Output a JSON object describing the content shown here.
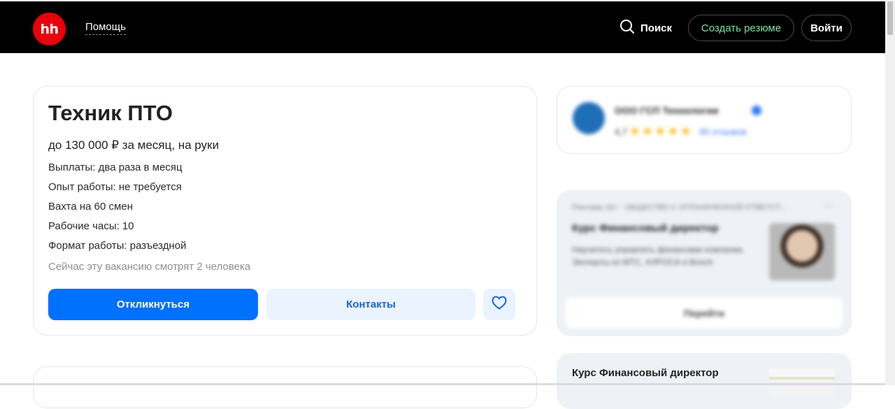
{
  "header": {
    "logo_text": "hh",
    "help_label": "Помощь",
    "search_label": "Поиск",
    "create_resume_label": "Создать резюме",
    "login_label": "Войти"
  },
  "vacancy": {
    "title": "Техник ПТО",
    "salary": "до 130 000 ₽ за месяц, на руки",
    "details": [
      "Выплаты: два раза в месяц",
      "Опыт работы: не требуется",
      "Вахта на 60 смен",
      "Рабочие часы: 10",
      "Формат работы: разъездной"
    ],
    "viewers": "Сейчас эту вакансию смотрят 2 человека",
    "apply_label": "Откликнуться",
    "contacts_label": "Контакты"
  },
  "company": {
    "name": "ООО ГСП Технологии",
    "rating": "4,7",
    "stars": 5,
    "reviews": "90 отзывов"
  },
  "ad": {
    "top_line": "Реклама 18+ · ОБЩЕСТВО С ОГРАНИЧЕННОЙ ОТВЕТСТ...",
    "menu": "···",
    "title": "Курс Финансовый директор",
    "description": "Научитесь управлять финансами компании. Эксперты из МТС, АЛРОСА и Bosch",
    "go_label": "Перейти"
  },
  "ad2": {
    "title": "Курс Финансовый директор"
  },
  "colors": {
    "header_bg": "#000000",
    "logo_red": "#e8000b",
    "primary_blue": "#0070ff",
    "create_resume_green": "#7fe0a0"
  }
}
